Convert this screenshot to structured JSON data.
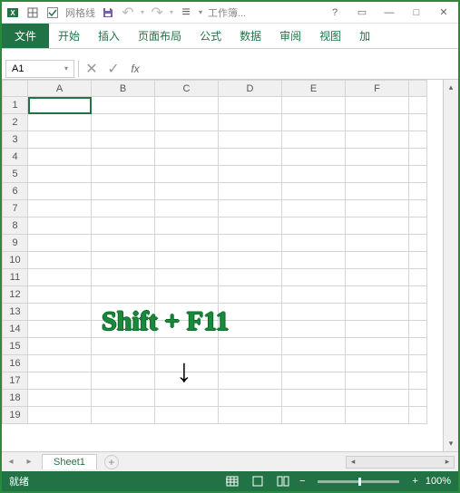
{
  "titlebar": {
    "gridlines_checkbox_label": "网格线",
    "gridlines_checked": true,
    "workbook_label": "工作簿..."
  },
  "ribbon": {
    "file": "文件",
    "tabs": [
      "开始",
      "插入",
      "页面布局",
      "公式",
      "数据",
      "审阅",
      "视图",
      "加"
    ]
  },
  "formula": {
    "namebox": "A1",
    "fx": "fx",
    "value": ""
  },
  "grid": {
    "columns": [
      "A",
      "B",
      "C",
      "D",
      "E",
      "F"
    ],
    "rows": [
      "1",
      "2",
      "3",
      "4",
      "5",
      "6",
      "7",
      "8",
      "9",
      "10",
      "11",
      "12",
      "13",
      "14",
      "15",
      "16",
      "17",
      "18",
      "19"
    ],
    "selected": "A1"
  },
  "overlay": {
    "text": "Shift + F11",
    "arrow": "↓"
  },
  "sheets": {
    "active": "Sheet1",
    "add_tooltip": "+"
  },
  "statusbar": {
    "ready": "就绪",
    "zoom": "100%"
  }
}
